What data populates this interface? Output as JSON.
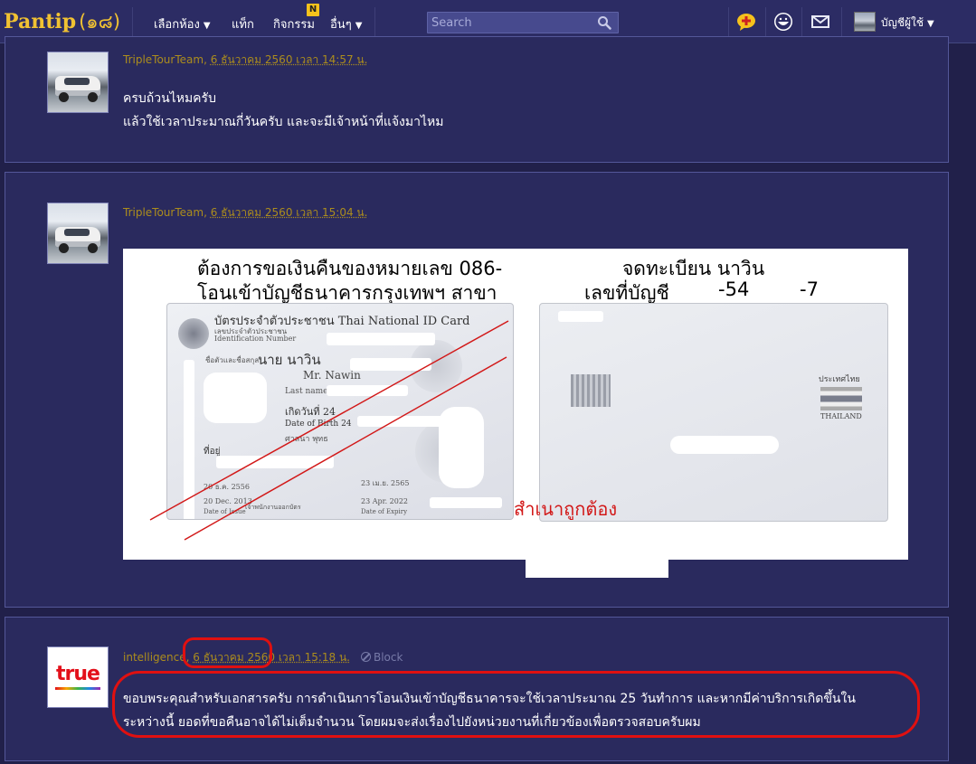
{
  "nav": {
    "logo_text": "Pantip",
    "logo_mark": "(ิ๑ć)",
    "items": [
      {
        "label": "เลือกห้อง",
        "has_caret": true
      },
      {
        "label": "แท็ก",
        "has_caret": false
      },
      {
        "label": "กิจกรรม",
        "has_caret": false,
        "badge": "N"
      },
      {
        "label": "อื่นๆ",
        "has_caret": true
      }
    ],
    "search_placeholder": "Search",
    "icons": [
      "add-chat-icon",
      "smiley-icon",
      "mail-icon"
    ],
    "user_label": "บัญชีผู้ใช้",
    "caret": "▼"
  },
  "posts": [
    {
      "author": "TripleTourTeam",
      "date": "6 ธันวาคม 2560 เวลา 14:57 น.",
      "lines": [
        "ครบถ้วนไหมครับ",
        "แล้วใช้เวลาประมาณกี่วันครับ และจะมีเจ้าหน้าที่แจ้งมาไหม"
      ]
    },
    {
      "author": "TripleTourTeam",
      "date": "6 ธันวาคม 2560 เวลา 15:04 น.",
      "image": {
        "line1_left": "ต้องการขอเงินคืนของหมายเลข 086-",
        "line1_right": "จดทะเบียน นาวิน",
        "line2_left": "โอนเข้าบัญชีธนาคารกรุงเทพฯ สาขา",
        "line2_right": "เลขที่บัญชี",
        "acct_mid": "-54",
        "acct_end": "-7",
        "card_title": "บัตรประจำตัวประชาชน Thai National ID Card",
        "card_idno_label": "เลขประจำตัวประชาชน",
        "card_idno_label_en": "Identification Number",
        "card_name_label": "ชื่อตัวและชื่อสกุล",
        "card_name_th": "นาย นาวิน",
        "card_name_en": "Mr. Nawin",
        "card_lastname": "Last name",
        "card_dob_th": "เกิดวันที่ 24",
        "card_dob_en": "Date of Birth 24",
        "card_religion": "ศาสนา พุทธ",
        "card_address": "ที่อยู่",
        "card_issue_th": "20 ธ.ค. 2556",
        "card_issue_en": "20 Dec. 2013",
        "card_issue_label": "Date of Issue",
        "card_expiry_th": "23 เม.ย. 2565",
        "card_expiry_en": "23 Apr. 2022",
        "card_expiry_label": "Date of Expiry",
        "card_officer": "เจ้าพนักงานออกบัตร",
        "back_country_th": "ประเทศไทย",
        "back_country_en": "THAILAND",
        "stamp": "สำเนาถูกต้อง"
      }
    },
    {
      "author": "intelligence",
      "date": "6 ธันวาคม 2560 เวลา 15:18 น.",
      "block_label": "Block",
      "avatar_text": "true",
      "lines": [
        "ขอบพระคุณสำหรับเอกสารครับ การดำเนินการโอนเงินเข้าบัญชีธนาคารจะใช้เวลาประมาณ 25 วันทำการ และหากมีค่าบริการเกิดขึ้นใน",
        "ระหว่างนี้ ยอดที่ขอคืนอาจได้ไม่เต็มจำนวน โดยผมจะส่งเรื่องไปยังหน่วยงานที่เกี่ยวข้องเพื่อตรวจสอบครับผม"
      ]
    }
  ],
  "colors": {
    "page_bg": "#21204a",
    "card_bg": "#2a2a5e",
    "meta": "#ac8d1d",
    "accent": "#f1c232",
    "annotation_red": "#e01010"
  }
}
